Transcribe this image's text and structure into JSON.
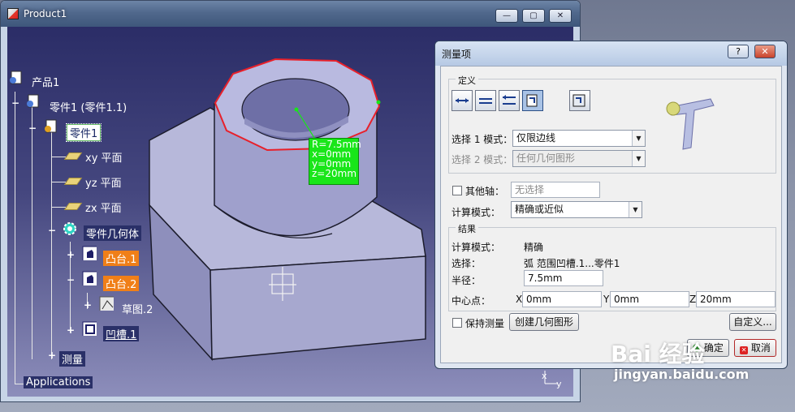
{
  "window": {
    "title": "Product1",
    "minimize_glyph": "—",
    "maximize_glyph": "▢",
    "close_glyph": "✕"
  },
  "tree": {
    "root": "产品1",
    "part_instance": "零件1 (零件1.1)",
    "part": "零件1",
    "planes": [
      "xy 平面",
      "yz 平面",
      "zx 平面"
    ],
    "body": "零件几何体",
    "pad1": "凸台.1",
    "pad2": "凸台.2",
    "sketch": "草图.2",
    "groove": "凹槽.1",
    "measure": "测量",
    "applications": "Applications"
  },
  "annotation": {
    "lines": [
      "R=7.5mm",
      "x=0mm",
      "y=0mm",
      "z=20mm"
    ],
    "color": "#19e619"
  },
  "axis_labels": {
    "x": "x",
    "y": "y"
  },
  "dialog": {
    "title": "测量项",
    "help_glyph": "?",
    "close_glyph": "✕",
    "definition_label": "定义",
    "selection1_label": "选择 1 模式：",
    "selection1_value": "仅限边线",
    "selection2_label": "选择 2 模式：",
    "selection2_value": "任何几何图形",
    "other_axis_label": "其他轴：",
    "other_axis_placeholder": "无选择",
    "calc_mode_label": "计算模式：",
    "calc_mode_value": "精确或近似",
    "results_label": "结果",
    "result_calc_mode_label": "计算模式：",
    "result_calc_mode_value": "精确",
    "result_selection_label": "选择：",
    "result_selection_value": "弧 范围凹槽.1...零件1",
    "radius_label": "半径：",
    "radius_value": "7.5mm",
    "center_label": "中心点：",
    "center_x_label": "X",
    "center_x_value": "0mm",
    "center_y_label": "Y",
    "center_y_value": "0mm",
    "center_z_label": "Z",
    "center_z_value": "20mm",
    "keep_measure_label": "保持测量",
    "create_geometry_button": "创建几何图形",
    "customize_button": "自定义...",
    "ok_button": "确定",
    "cancel_button": "取消"
  },
  "watermark": {
    "logo": "Bai 经验",
    "url": "jingyan.baidu.com"
  },
  "colors": {
    "viewport_top": "#2b2d67",
    "selected_edge": "#e8202a",
    "tree_highlight_orange": "#f07f18"
  }
}
